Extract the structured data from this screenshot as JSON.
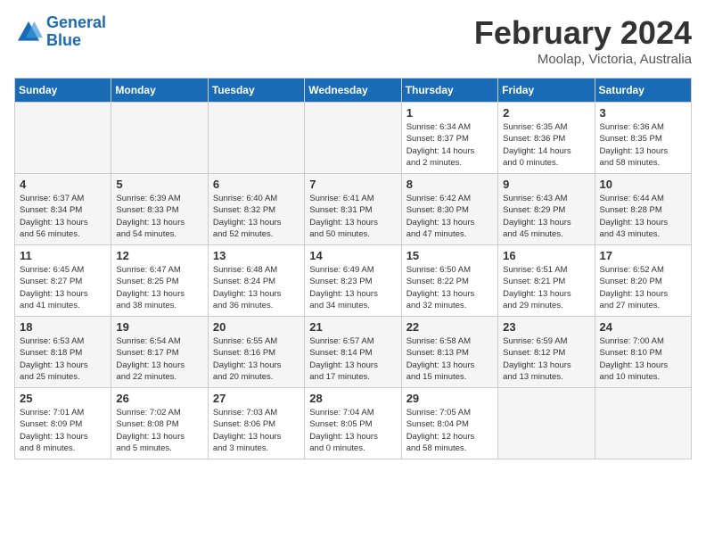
{
  "header": {
    "logo_line1": "General",
    "logo_line2": "Blue",
    "month_title": "February 2024",
    "location": "Moolap, Victoria, Australia"
  },
  "days_of_week": [
    "Sunday",
    "Monday",
    "Tuesday",
    "Wednesday",
    "Thursday",
    "Friday",
    "Saturday"
  ],
  "weeks": [
    [
      {
        "day": "",
        "info": "",
        "empty": true
      },
      {
        "day": "",
        "info": "",
        "empty": true
      },
      {
        "day": "",
        "info": "",
        "empty": true
      },
      {
        "day": "",
        "info": "",
        "empty": true
      },
      {
        "day": "1",
        "info": "Sunrise: 6:34 AM\nSunset: 8:37 PM\nDaylight: 14 hours\nand 2 minutes.",
        "empty": false
      },
      {
        "day": "2",
        "info": "Sunrise: 6:35 AM\nSunset: 8:36 PM\nDaylight: 14 hours\nand 0 minutes.",
        "empty": false
      },
      {
        "day": "3",
        "info": "Sunrise: 6:36 AM\nSunset: 8:35 PM\nDaylight: 13 hours\nand 58 minutes.",
        "empty": false
      }
    ],
    [
      {
        "day": "4",
        "info": "Sunrise: 6:37 AM\nSunset: 8:34 PM\nDaylight: 13 hours\nand 56 minutes.",
        "empty": false
      },
      {
        "day": "5",
        "info": "Sunrise: 6:39 AM\nSunset: 8:33 PM\nDaylight: 13 hours\nand 54 minutes.",
        "empty": false
      },
      {
        "day": "6",
        "info": "Sunrise: 6:40 AM\nSunset: 8:32 PM\nDaylight: 13 hours\nand 52 minutes.",
        "empty": false
      },
      {
        "day": "7",
        "info": "Sunrise: 6:41 AM\nSunset: 8:31 PM\nDaylight: 13 hours\nand 50 minutes.",
        "empty": false
      },
      {
        "day": "8",
        "info": "Sunrise: 6:42 AM\nSunset: 8:30 PM\nDaylight: 13 hours\nand 47 minutes.",
        "empty": false
      },
      {
        "day": "9",
        "info": "Sunrise: 6:43 AM\nSunset: 8:29 PM\nDaylight: 13 hours\nand 45 minutes.",
        "empty": false
      },
      {
        "day": "10",
        "info": "Sunrise: 6:44 AM\nSunset: 8:28 PM\nDaylight: 13 hours\nand 43 minutes.",
        "empty": false
      }
    ],
    [
      {
        "day": "11",
        "info": "Sunrise: 6:45 AM\nSunset: 8:27 PM\nDaylight: 13 hours\nand 41 minutes.",
        "empty": false
      },
      {
        "day": "12",
        "info": "Sunrise: 6:47 AM\nSunset: 8:25 PM\nDaylight: 13 hours\nand 38 minutes.",
        "empty": false
      },
      {
        "day": "13",
        "info": "Sunrise: 6:48 AM\nSunset: 8:24 PM\nDaylight: 13 hours\nand 36 minutes.",
        "empty": false
      },
      {
        "day": "14",
        "info": "Sunrise: 6:49 AM\nSunset: 8:23 PM\nDaylight: 13 hours\nand 34 minutes.",
        "empty": false
      },
      {
        "day": "15",
        "info": "Sunrise: 6:50 AM\nSunset: 8:22 PM\nDaylight: 13 hours\nand 32 minutes.",
        "empty": false
      },
      {
        "day": "16",
        "info": "Sunrise: 6:51 AM\nSunset: 8:21 PM\nDaylight: 13 hours\nand 29 minutes.",
        "empty": false
      },
      {
        "day": "17",
        "info": "Sunrise: 6:52 AM\nSunset: 8:20 PM\nDaylight: 13 hours\nand 27 minutes.",
        "empty": false
      }
    ],
    [
      {
        "day": "18",
        "info": "Sunrise: 6:53 AM\nSunset: 8:18 PM\nDaylight: 13 hours\nand 25 minutes.",
        "empty": false
      },
      {
        "day": "19",
        "info": "Sunrise: 6:54 AM\nSunset: 8:17 PM\nDaylight: 13 hours\nand 22 minutes.",
        "empty": false
      },
      {
        "day": "20",
        "info": "Sunrise: 6:55 AM\nSunset: 8:16 PM\nDaylight: 13 hours\nand 20 minutes.",
        "empty": false
      },
      {
        "day": "21",
        "info": "Sunrise: 6:57 AM\nSunset: 8:14 PM\nDaylight: 13 hours\nand 17 minutes.",
        "empty": false
      },
      {
        "day": "22",
        "info": "Sunrise: 6:58 AM\nSunset: 8:13 PM\nDaylight: 13 hours\nand 15 minutes.",
        "empty": false
      },
      {
        "day": "23",
        "info": "Sunrise: 6:59 AM\nSunset: 8:12 PM\nDaylight: 13 hours\nand 13 minutes.",
        "empty": false
      },
      {
        "day": "24",
        "info": "Sunrise: 7:00 AM\nSunset: 8:10 PM\nDaylight: 13 hours\nand 10 minutes.",
        "empty": false
      }
    ],
    [
      {
        "day": "25",
        "info": "Sunrise: 7:01 AM\nSunset: 8:09 PM\nDaylight: 13 hours\nand 8 minutes.",
        "empty": false
      },
      {
        "day": "26",
        "info": "Sunrise: 7:02 AM\nSunset: 8:08 PM\nDaylight: 13 hours\nand 5 minutes.",
        "empty": false
      },
      {
        "day": "27",
        "info": "Sunrise: 7:03 AM\nSunset: 8:06 PM\nDaylight: 13 hours\nand 3 minutes.",
        "empty": false
      },
      {
        "day": "28",
        "info": "Sunrise: 7:04 AM\nSunset: 8:05 PM\nDaylight: 13 hours\nand 0 minutes.",
        "empty": false
      },
      {
        "day": "29",
        "info": "Sunrise: 7:05 AM\nSunset: 8:04 PM\nDaylight: 12 hours\nand 58 minutes.",
        "empty": false
      },
      {
        "day": "",
        "info": "",
        "empty": true
      },
      {
        "day": "",
        "info": "",
        "empty": true
      }
    ]
  ]
}
